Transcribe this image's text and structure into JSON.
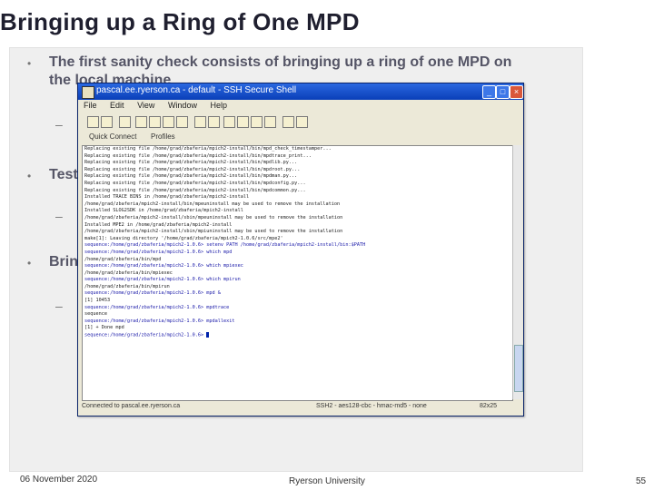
{
  "slide": {
    "title": "Bringing up a Ring of One MPD",
    "bullet1_line1": "The first sanity check consists of bringing up a ring of one MPD on",
    "bullet1_line2": "the local machine",
    "bullet2_partial": "Test",
    "bullet3_partial": "Brin",
    "bullet_glyph": "•",
    "dash_glyph": "–"
  },
  "footer": {
    "date": "06 November 2020",
    "org": "Ryerson University",
    "page": "55"
  },
  "window": {
    "title": "pascal.ee.ryerson.ca - default - SSH Secure Shell",
    "menu": [
      "File",
      "Edit",
      "View",
      "Window",
      "Help"
    ],
    "quick_connect": "Quick Connect",
    "profiles": "Profiles",
    "terminal_lines": [
      "Replacing existing file /home/grad/zbaferia/mpich2-install/bin/mpd_check_timestamper...",
      "Replacing existing file /home/grad/zbaferia/mpich2-install/bin/mpdtrace_print...",
      "Replacing existing file /home/grad/zbaferia/mpich2-install/bin/mpdlib.py...",
      "Replacing existing file /home/grad/zbaferia/mpich2-install/bin/mpdroot.py...",
      "Replacing existing file /home/grad/zbaferia/mpich2-install/bin/mpdman.py...",
      "Replacing existing file /home/grad/zbaferia/mpich2-install/bin/mpdconfig.py...",
      "Replacing existing file /home/grad/zbaferia/mpich2-install/bin/mpdcommon.py...",
      "Installed TRACE BINS in /home/grad/zbaferia/mpich2-install",
      "/home/grad/zbaferia/mpich2-install/bin/mpeuninstall may be used to remove the installation",
      "Installed SLOG2SDK in /home/grad/zbaferia/mpich2-install",
      "/home/grad/zbaferia/mpich2-install/sbin/mpeuninstall may be used to remove the installation",
      "Installed MPE2 in /home/grad/zbaferia/mpich2-install",
      "/home/grad/zbaferia/mpich2-install/sbin/mpiuninstall may be used to remove the installation",
      "make[1]: Leaving directory '/home/grad/zbaferia/mpich2-1.0.6/src/mpe2'",
      "sequence:/home/grad/zbaferia/mpich2-1.0.6> setenv PATH /home/grad/zbaferia/mpich2-install/bin:$PATH",
      "sequence:/home/grad/zbaferia/mpich2-1.0.6> which mpd",
      "/home/grad/zbaferia/bin/mpd",
      "sequence:/home/grad/zbaferia/mpich2-1.0.6> which mpiexec",
      "/home/grad/zbaferia/bin/mpiexec",
      "sequence:/home/grad/zbaferia/mpich2-1.0.6> which mpirun",
      "/home/grad/zbaferia/bin/mpirun",
      "sequence:/home/grad/zbaferia/mpich2-1.0.6> mpd &",
      "[1] 10453",
      "sequence:/home/grad/zbaferia/mpich2-1.0.6> mpdtrace",
      "sequence",
      "sequence:/home/grad/zbaferia/mpich2-1.0.6> mpdallexit",
      "[1]  + Done        mpd",
      "sequence:/home/grad/zbaferia/mpich2-1.0.6> "
    ],
    "status": {
      "left": "Connected to pascal.ee.ryerson.ca",
      "proto": "SSH2 - aes128-cbc - hmac-md5 - none",
      "size": "82x25"
    }
  }
}
